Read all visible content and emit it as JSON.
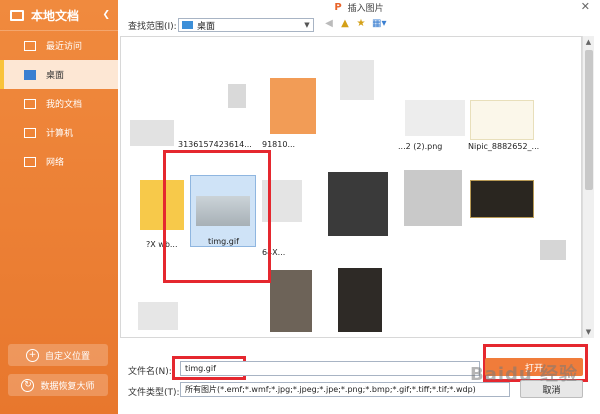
{
  "window": {
    "title": "插入图片",
    "app_logo": "P"
  },
  "sidebar": {
    "header": "本地文档",
    "items": [
      {
        "label": "最近访问",
        "icon": "folder-icon"
      },
      {
        "label": "桌面",
        "icon": "desktop-icon"
      },
      {
        "label": "我的文档",
        "icon": "folder-icon"
      },
      {
        "label": "计算机",
        "icon": "computer-icon"
      },
      {
        "label": "网络",
        "icon": "network-icon"
      }
    ],
    "add_location": "自定义位置",
    "recover": "数据恢复大师"
  },
  "toolbar": {
    "lookin_label": "查找范围(I):",
    "lookin_value": "桌面"
  },
  "files": [
    {
      "name": "3136157423614..."
    },
    {
      "name": "91810..."
    },
    {
      "name": "...2 (2).png"
    },
    {
      "name": "Nipic_8882652_..."
    },
    {
      "name": "?X wb..."
    },
    {
      "name": "timg.gif"
    },
    {
      "name": "64X..."
    }
  ],
  "bottom": {
    "filename_label": "文件名(N):",
    "filename_value": "timg.gif",
    "filetype_label": "文件类型(T):",
    "filetype_value": "所有图片(*.emf;*.wmf;*.jpg;*.jpeg;*.jpe;*.png;*.bmp;*.gif;*.tiff;*.tif;*.wdp)",
    "open_button": "打开",
    "cancel_button": "取消"
  },
  "watermark": "Baidu 经验",
  "colors": {
    "sidebar": "#f08a3e",
    "accent": "#e5282f",
    "selection": "#cfe3f7"
  }
}
